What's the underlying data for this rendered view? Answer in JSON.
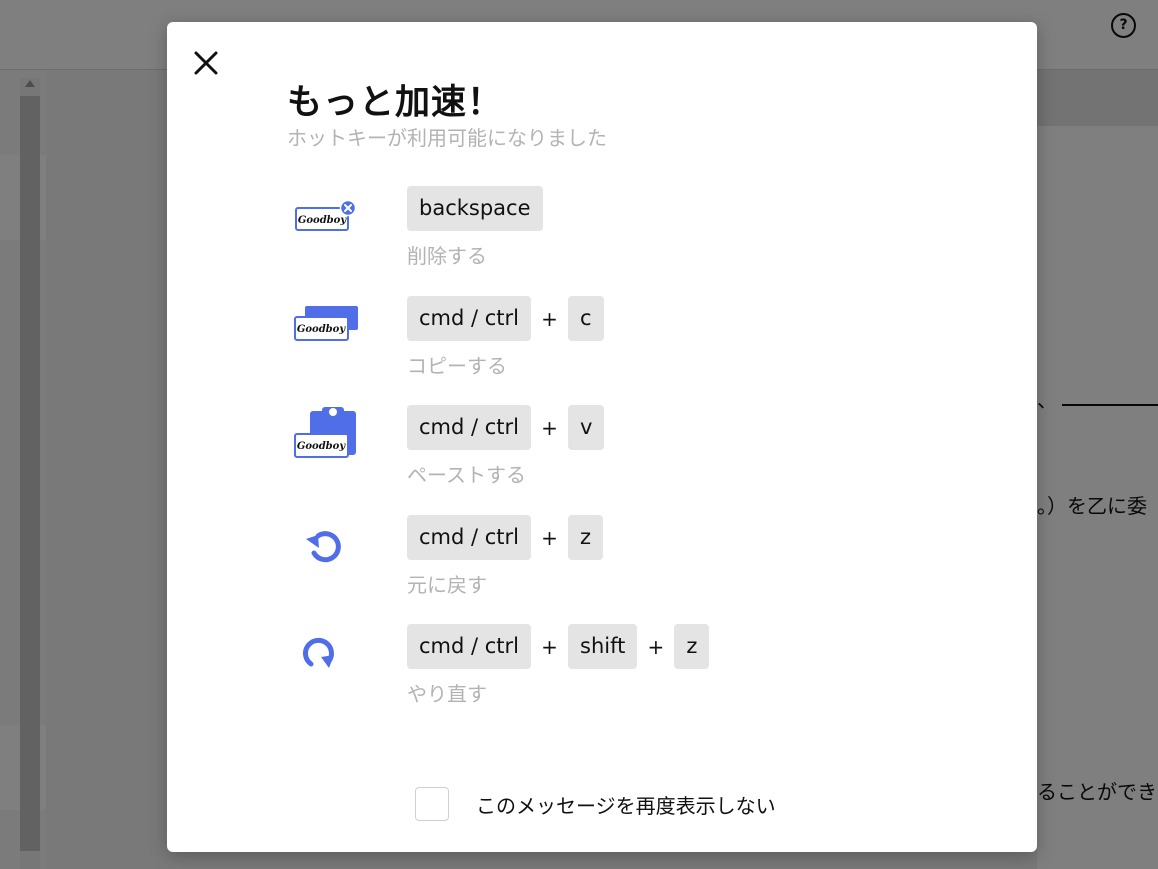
{
  "background": {
    "help_icon": "question-circle-icon",
    "help_glyph": "?",
    "doc_fragments": [
      {
        "text": "、"
      },
      {
        "text": "。）を乙に委"
      },
      {
        "text": "ることができ"
      }
    ]
  },
  "modal": {
    "close_icon": "close-icon",
    "title": "もっと加速！",
    "subtitle": "ホットキーが利用可能になりました",
    "shortcuts": [
      {
        "icon": "delete-card-icon",
        "keys": [
          "backspace"
        ],
        "description": "削除する"
      },
      {
        "icon": "copy-card-icon",
        "keys": [
          "cmd / ctrl",
          "c"
        ],
        "description": "コピーする"
      },
      {
        "icon": "paste-clipboard-icon",
        "keys": [
          "cmd / ctrl",
          "v"
        ],
        "description": "ペーストする"
      },
      {
        "icon": "undo-icon",
        "keys": [
          "cmd / ctrl",
          "z"
        ],
        "description": "元に戻す"
      },
      {
        "icon": "redo-icon",
        "keys": [
          "cmd / ctrl",
          "shift",
          "z"
        ],
        "description": "やり直す"
      }
    ],
    "key_separator": "+",
    "icon_card_label": "Goodboy",
    "dont_show_again": {
      "label": "このメッセージを再度表示しない",
      "checked": false
    }
  },
  "colors": {
    "accent": "#4f6ee8",
    "key_bg": "#e4e4e4",
    "muted_text": "#b3b3b3",
    "overlay": "rgba(0,0,0,0.5)"
  }
}
